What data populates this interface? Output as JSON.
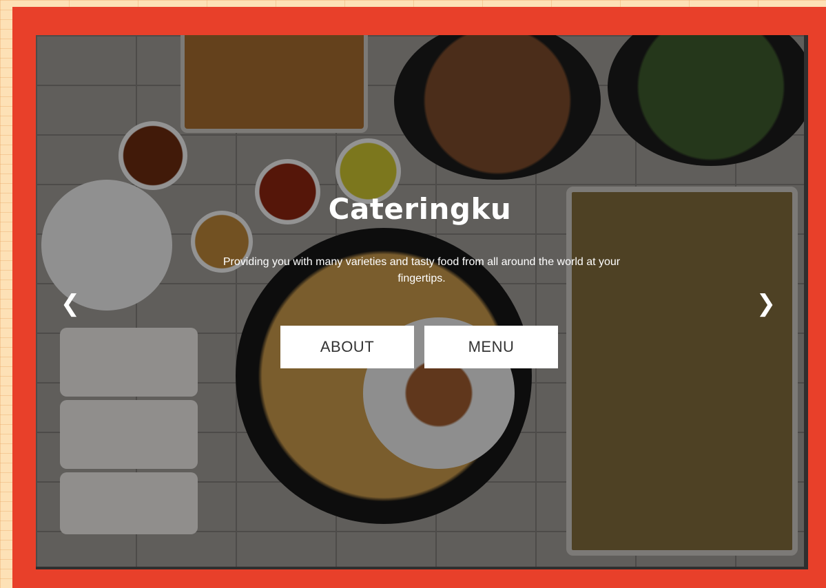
{
  "hero": {
    "title": "Cateringku",
    "subtitle": "Providing you with many varieties and tasty food from all around the world at your fingertips.",
    "buttons": {
      "about": "ABOUT",
      "menu": "MENU"
    },
    "arrows": {
      "prev": "❮",
      "next": "❯"
    }
  },
  "colors": {
    "frame": "#e8402a",
    "page_background": "#fde1b6",
    "button_background": "#ffffff",
    "button_text": "#333333"
  },
  "icons": [
    "chevron-left-icon",
    "chevron-right-icon"
  ]
}
